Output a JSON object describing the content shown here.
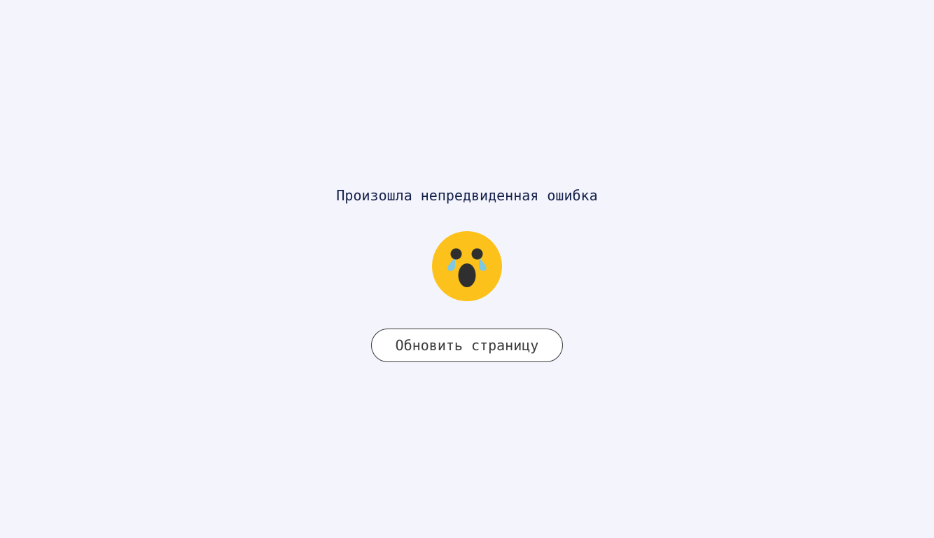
{
  "error": {
    "message": "Произошла непредвиденная ошибка",
    "icon": "crying-face-icon",
    "reload_button_label": "Обновить страницу"
  },
  "colors": {
    "background": "#f3f4fc",
    "message_text": "#14204a",
    "emoji_face": "#fcc21b",
    "emoji_tears": "#7fc8e3",
    "emoji_features": "#2f2f2f",
    "button_border": "#3a3a3a"
  }
}
